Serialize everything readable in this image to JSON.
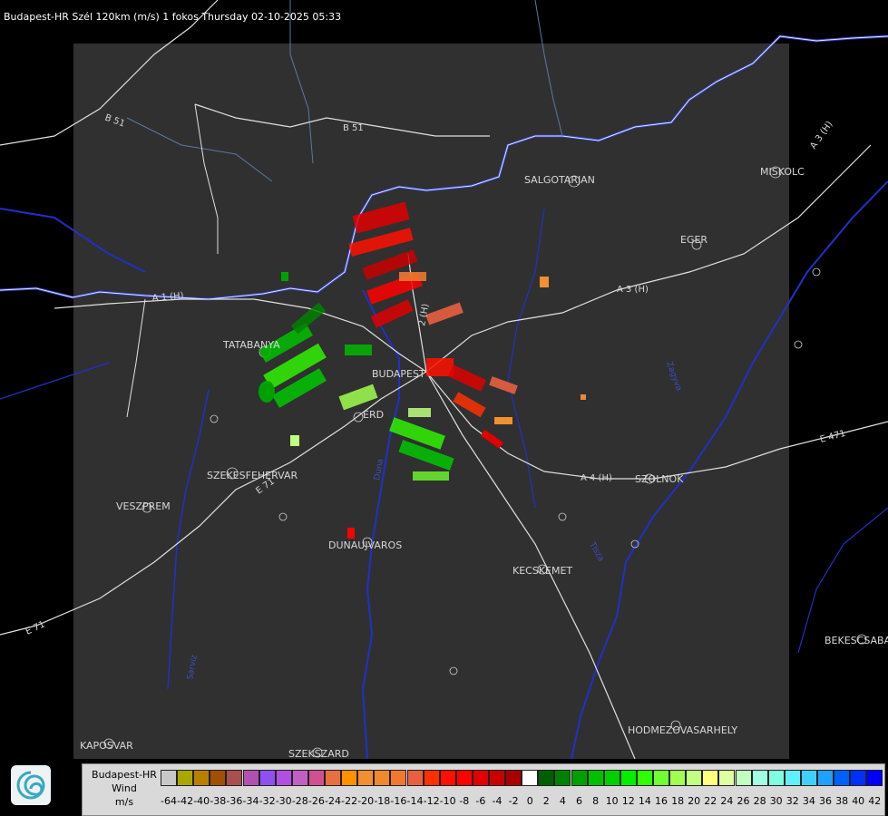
{
  "title": "Budapest-HR Szél 120km (m/s) 1 fokos Thursday 02-10-2025 05:33",
  "cities": [
    {
      "id": "salgotarjan",
      "label": "SALGOTARJAN"
    },
    {
      "id": "miskolc",
      "label": "MISKOLC"
    },
    {
      "id": "eger",
      "label": "EGER"
    },
    {
      "id": "tatabanya",
      "label": "TATABANYA"
    },
    {
      "id": "budapest",
      "label": "BUDAPEST"
    },
    {
      "id": "erd",
      "label": "ERD"
    },
    {
      "id": "szekesfehervar",
      "label": "SZEKESFEHERVAR"
    },
    {
      "id": "veszprem",
      "label": "VESZPREM"
    },
    {
      "id": "dunaujvaros",
      "label": "DUNAUJVAROS"
    },
    {
      "id": "kecskemet",
      "label": "KECSKEMET"
    },
    {
      "id": "szolnok",
      "label": "SZOLNOK"
    },
    {
      "id": "bekescsaba",
      "label": "BEKESCSABA"
    },
    {
      "id": "hodmezovasarhely",
      "label": "HODMEZOVASARHELY"
    },
    {
      "id": "kaposvar",
      "label": "KAPOSVAR"
    },
    {
      "id": "szekszard",
      "label": "SZEKSZARD"
    }
  ],
  "roads": [
    {
      "id": "b51-west",
      "label": "B 51"
    },
    {
      "id": "b51-east",
      "label": "B 51"
    },
    {
      "id": "a3-ne",
      "label": "A 3 (H)"
    },
    {
      "id": "a3",
      "label": "A 3 (H)"
    },
    {
      "id": "a4",
      "label": "A 4 (H)"
    },
    {
      "id": "e471",
      "label": "E 471"
    },
    {
      "id": "e71",
      "label": "E 71"
    },
    {
      "id": "m2",
      "label": "2 (H)"
    },
    {
      "id": "a1",
      "label": "A 1 (H)"
    },
    {
      "id": "e71b",
      "label": "E 71"
    }
  ],
  "rivers": [
    {
      "id": "duna",
      "label": "Duna"
    },
    {
      "id": "tisza",
      "label": "Tisza"
    },
    {
      "id": "sarviz",
      "label": "Sarviz"
    },
    {
      "id": "zagyva",
      "label": "Zagyva"
    }
  ],
  "legend": {
    "line1": "Budapest-HR",
    "line2": "Wind",
    "unit": "m/s",
    "ticks": [
      "-64",
      "-42",
      "-40",
      "-38",
      "-36",
      "-34",
      "-32",
      "-30",
      "-28",
      "-26",
      "-24",
      "-22",
      "-20",
      "-18",
      "-16",
      "-14",
      "-12",
      "-10",
      "-8",
      "-6",
      "-4",
      "-2",
      "0",
      "2",
      "4",
      "6",
      "8",
      "10",
      "12",
      "14",
      "16",
      "18",
      "20",
      "22",
      "24",
      "26",
      "28",
      "30",
      "32",
      "34",
      "36",
      "38",
      "40",
      "42"
    ],
    "colors": [
      "#c8c8c8",
      "#a8a800",
      "#b88000",
      "#a05000",
      "#a85050",
      "#b050b0",
      "#9050f0",
      "#b050e0",
      "#c060c0",
      "#d05090",
      "#e87040",
      "#ff9000",
      "#f09030",
      "#f08830",
      "#f07830",
      "#e86040",
      "#ff3000",
      "#ff1000",
      "#ff0000",
      "#e00000",
      "#c80000",
      "#a80000",
      "#ffffff",
      "#006000",
      "#008000",
      "#00a000",
      "#00c000",
      "#00d000",
      "#00f000",
      "#30ff00",
      "#70ff30",
      "#a0ff50",
      "#c0ff80",
      "#ffff80",
      "#e0ffa0",
      "#c0ffc0",
      "#a0ffe0",
      "#80ffe0",
      "#60f0ff",
      "#40d0ff",
      "#20a0ff",
      "#0060ff",
      "#0030ff",
      "#0000ff"
    ]
  }
}
